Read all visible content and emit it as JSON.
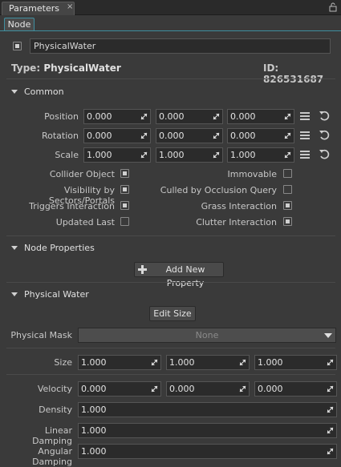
{
  "window": {
    "tab_label": "Parameters",
    "close_glyph": "×"
  },
  "subtab": {
    "label": "Node"
  },
  "node": {
    "name": "PhysicalWater",
    "type_label": "Type:",
    "type_value": "PhysicalWater",
    "id_label": "ID:",
    "id_value": "826531687"
  },
  "common": {
    "title": "Common",
    "position": {
      "label": "Position",
      "values": [
        "0.000",
        "0.000",
        "0.000"
      ]
    },
    "rotation": {
      "label": "Rotation",
      "values": [
        "0.000",
        "0.000",
        "0.000"
      ]
    },
    "scale": {
      "label": "Scale",
      "values": [
        "1.000",
        "1.000",
        "1.000"
      ]
    },
    "flags_left": [
      {
        "label": "Collider Object",
        "checked": true
      },
      {
        "label": "Visibility by Sectors/Portals",
        "checked": true
      },
      {
        "label": "Triggers Interaction",
        "checked": true
      },
      {
        "label": "Updated Last",
        "checked": false
      }
    ],
    "flags_right": [
      {
        "label": "Immovable",
        "checked": false
      },
      {
        "label": "Culled by Occlusion Query",
        "checked": false
      },
      {
        "label": "Grass Interaction",
        "checked": true
      },
      {
        "label": "Clutter Interaction",
        "checked": true
      }
    ]
  },
  "node_properties": {
    "title": "Node Properties",
    "add_button": "Add New Property"
  },
  "physical_water": {
    "title": "Physical Water",
    "edit_size_button": "Edit Size",
    "mask_label": "Physical Mask",
    "mask_value": "None",
    "size": {
      "label": "Size",
      "values": [
        "1.000",
        "1.000",
        "1.000"
      ]
    },
    "velocity": {
      "label": "Velocity",
      "values": [
        "0.000",
        "0.000",
        "0.000"
      ]
    },
    "density": {
      "label": "Density",
      "value": "1.000"
    },
    "linear_damping": {
      "label": "Linear Damping",
      "value": "1.000"
    },
    "angular_damping": {
      "label": "Angular Damping",
      "value": "1.000"
    }
  },
  "colors": {
    "accent": "#3f8fa0",
    "background": "#3a3a3a",
    "field": "#2b2b2b"
  }
}
